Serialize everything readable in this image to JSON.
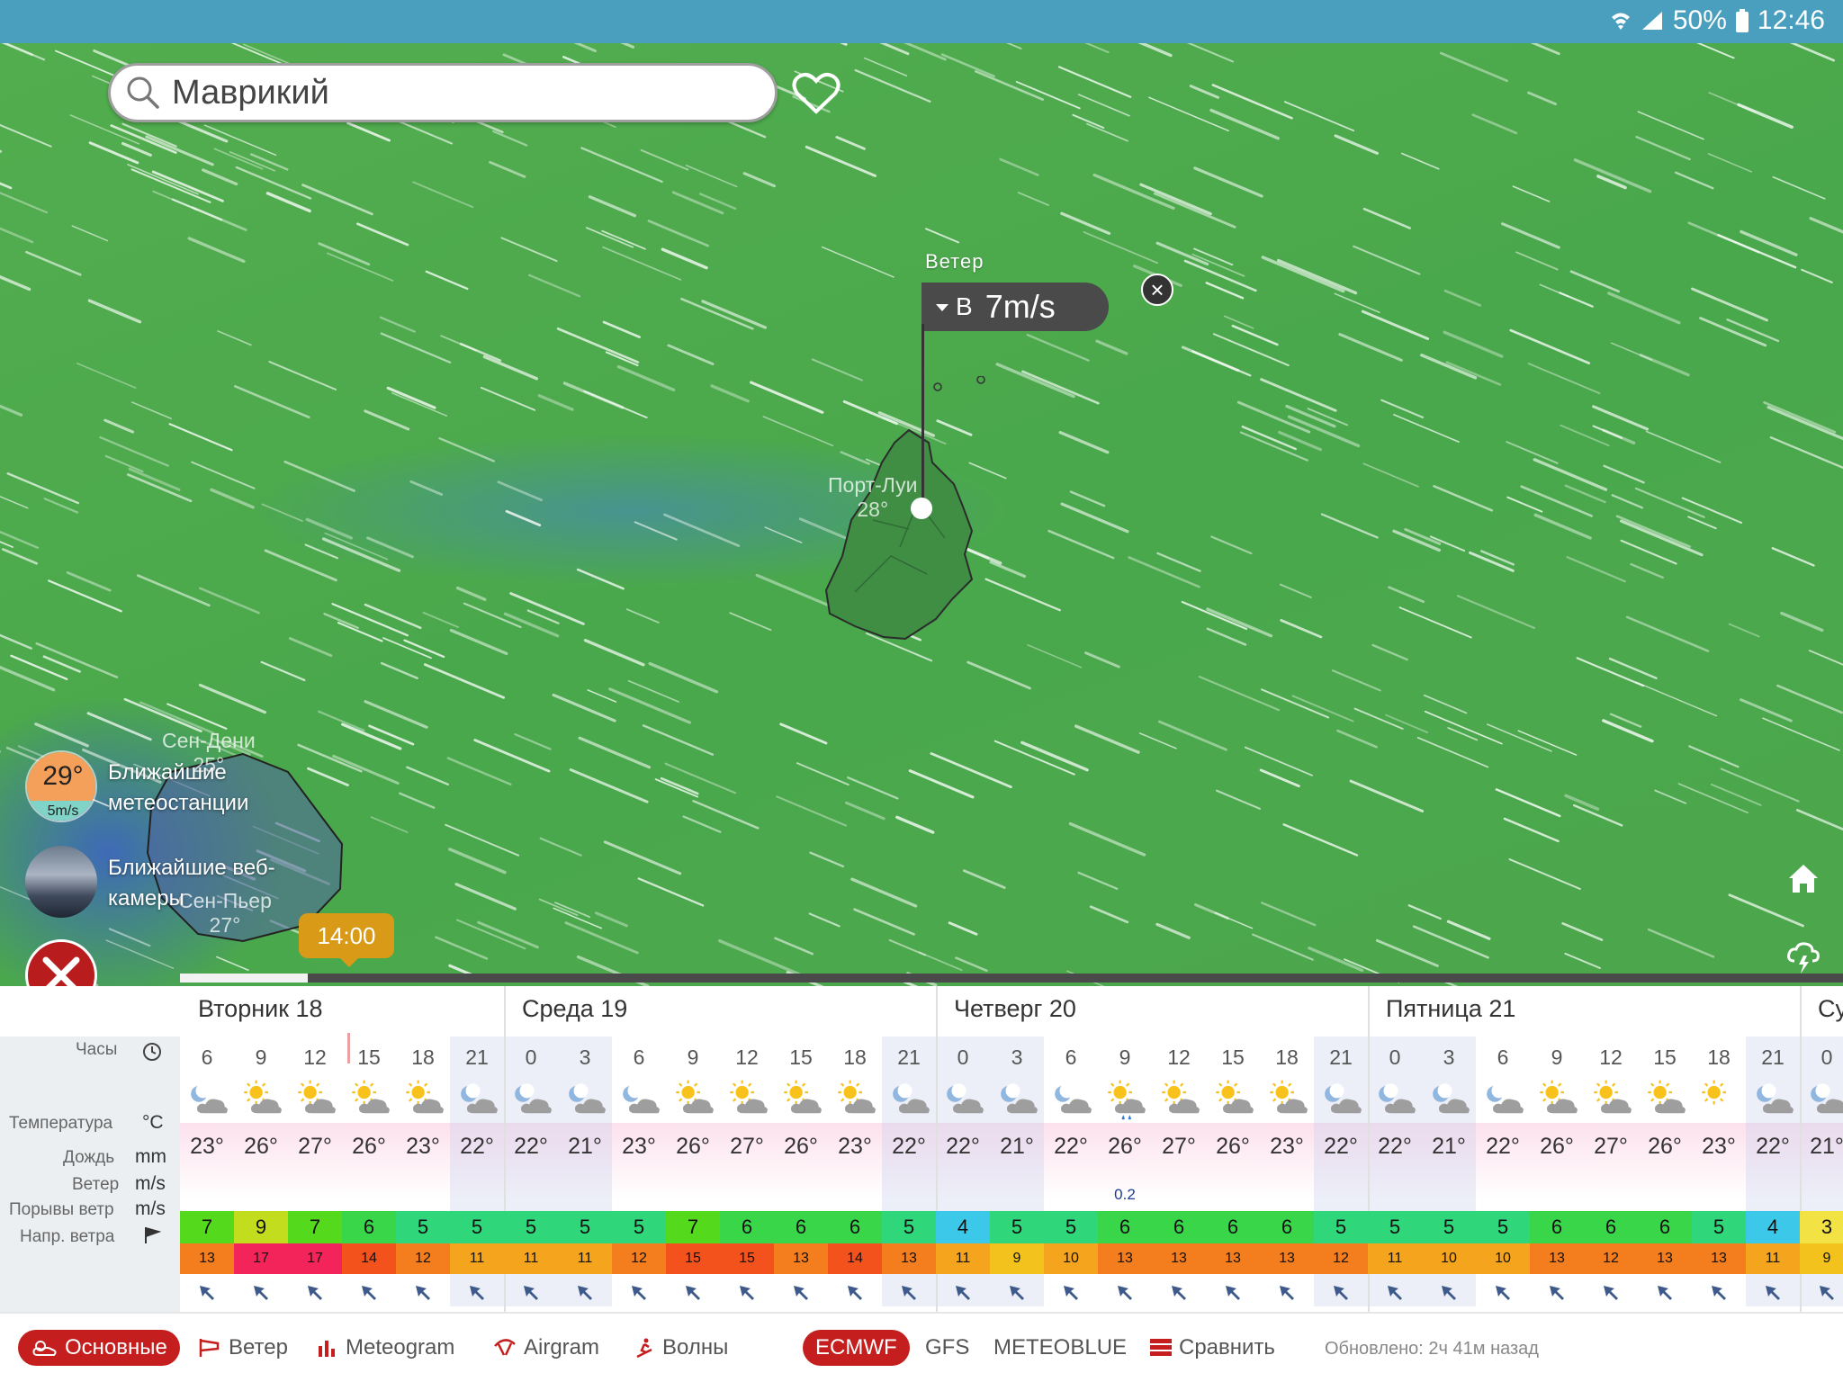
{
  "status": {
    "battery": "50%",
    "time": "12:46"
  },
  "search": {
    "value": "Маврикий"
  },
  "wind_popup": {
    "label": "Ветер",
    "direction": "В",
    "speed": "7m/s"
  },
  "cities": [
    {
      "name": "Порт-Луи",
      "temp": "28°"
    },
    {
      "name": "Сен-Дени",
      "temp": "25°"
    },
    {
      "name": "Сен-Пьер",
      "temp": "27°"
    }
  ],
  "stations": {
    "temp": "29°",
    "wind": "5m/s",
    "label": "Ближайшие метеостанции"
  },
  "webcams": {
    "label": "Ближайшие веб-камеры"
  },
  "timeline": {
    "time": "14:00",
    "progress": 0.077
  },
  "rows": {
    "hours": "Часы",
    "temp": "Температура",
    "temp_unit": "°C",
    "rain": "Дождь",
    "rain_unit": "mm",
    "wind": "Ветер",
    "wind_unit": "m/s",
    "gust": "Порывы ветр",
    "gust_unit": "m/s",
    "dir": "Напр. ветра"
  },
  "days": [
    "Вторник 18",
    "Среда 19",
    "Четверг 20",
    "Пятница 21",
    "Су"
  ],
  "forecast": {
    "hours": [
      "6",
      "9",
      "12",
      "15",
      "18",
      "21",
      "0",
      "3",
      "6",
      "9",
      "12",
      "15",
      "18",
      "21",
      "0",
      "3",
      "6",
      "9",
      "12",
      "15",
      "18",
      "21",
      "0",
      "3",
      "6",
      "9",
      "12",
      "15",
      "18",
      "21",
      "0"
    ],
    "icons": [
      "moon-cloud",
      "sun-cloud",
      "sun-cloud",
      "sun-cloud",
      "sun-cloud",
      "moon-cloud",
      "moon-cloud",
      "moon-cloud",
      "moon-cloud",
      "sun-cloud",
      "sun-cloud",
      "sun-cloud",
      "sun-cloud",
      "moon-cloud",
      "moon-cloud",
      "moon-cloud",
      "moon-cloud",
      "sun-rain",
      "sun-cloud",
      "sun-cloud",
      "sun-cloud",
      "moon-cloud",
      "moon-cloud",
      "moon-cloud",
      "moon-cloud",
      "sun-cloud",
      "sun-cloud",
      "sun-cloud",
      "sun",
      "moon-cloud",
      "moon-cloud"
    ],
    "temps": [
      "23°",
      "26°",
      "27°",
      "26°",
      "23°",
      "22°",
      "22°",
      "21°",
      "23°",
      "26°",
      "27°",
      "26°",
      "23°",
      "22°",
      "22°",
      "21°",
      "22°",
      "26°",
      "27°",
      "26°",
      "23°",
      "22°",
      "22°",
      "21°",
      "22°",
      "26°",
      "27°",
      "26°",
      "23°",
      "22°",
      "21°"
    ],
    "rain": [
      "",
      "",
      "",
      "",
      "",
      "",
      "",
      "",
      "",
      "",
      "",
      "",
      "",
      "",
      "",
      "",
      "",
      "0.2",
      "",
      "",
      "",
      "",
      "",
      "",
      "",
      "",
      "",
      "",
      "",
      "",
      ""
    ],
    "wind": [
      "7",
      "9",
      "7",
      "6",
      "5",
      "5",
      "5",
      "5",
      "5",
      "7",
      "6",
      "6",
      "6",
      "5",
      "4",
      "5",
      "5",
      "6",
      "6",
      "6",
      "6",
      "5",
      "5",
      "5",
      "5",
      "6",
      "6",
      "6",
      "5",
      "4",
      "3"
    ],
    "gust": [
      "13",
      "17",
      "17",
      "14",
      "12",
      "11",
      "11",
      "11",
      "12",
      "15",
      "15",
      "13",
      "14",
      "13",
      "11",
      "9",
      "10",
      "13",
      "13",
      "13",
      "13",
      "12",
      "11",
      "10",
      "10",
      "13",
      "12",
      "13",
      "13",
      "11",
      "9"
    ]
  },
  "nav": {
    "tabs": [
      "Основные",
      "Ветер",
      "Meteogram",
      "Airgram",
      "Волны"
    ],
    "models": [
      "ECMWF",
      "GFS",
      "METEOBLUE"
    ],
    "compare": "Сравнить",
    "updated": "Обновлено: 2ч 41м назад"
  },
  "colors": {
    "accent": "#c41e1e",
    "map_green": "#4caf50",
    "status_bar": "#4a9fbf"
  }
}
